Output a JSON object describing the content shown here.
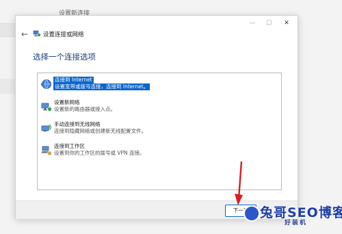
{
  "background": {
    "title": "设置新连接"
  },
  "dialog": {
    "title": "设置连接或网络",
    "heading": "选择一个连接选项",
    "window_controls": {
      "minimize": "—",
      "maximize": "☐",
      "close": "✕"
    },
    "back_icon": "back-arrow-icon",
    "options": [
      {
        "title": "连接到 Internet",
        "desc": "设置宽带或拨号连接，连接到 Internet。",
        "icon": "globe-icon",
        "selected": true
      },
      {
        "title": "设置新网络",
        "desc": "设置新的路由器或接入点。",
        "icon": "router-icon",
        "selected": false
      },
      {
        "title": "手动连接到无线网络",
        "desc": "连接到隐藏网络或创建新无线配置文件。",
        "icon": "wireless-icon",
        "selected": false
      },
      {
        "title": "连接到工作区",
        "desc": "设置到你的工作区的拨号或 VPN 连接。",
        "icon": "workplace-icon",
        "selected": false
      }
    ],
    "next_button": "下一页"
  },
  "colors": {
    "selection": "#0a66cc",
    "heading": "#1c3f7a",
    "annotation_arrow": "#d81e1e"
  },
  "watermark": {
    "text": "兔哥SEO博客",
    "sub": "好装机"
  }
}
